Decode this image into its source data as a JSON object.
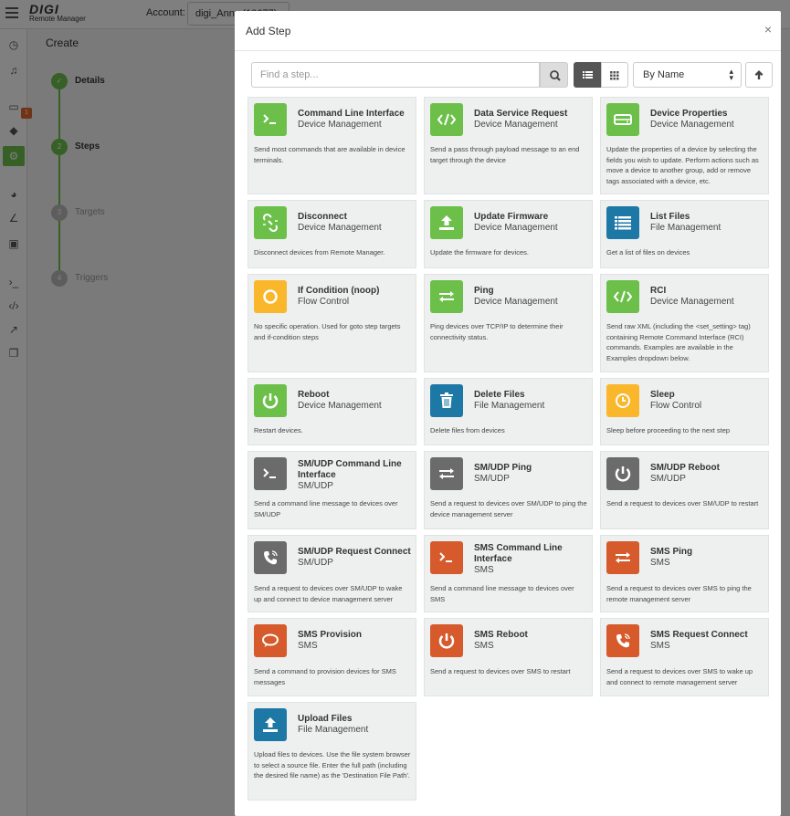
{
  "background": {
    "brand": "DIGI",
    "brand_sub": "Remote Manager",
    "account_label": "Account:",
    "account_value": "digi_Anny (10677)",
    "page_title": "Create",
    "wizard_steps": [
      {
        "num": "",
        "label": "Details",
        "done": true
      },
      {
        "num": "2",
        "label": "Steps",
        "done": true
      },
      {
        "num": "3",
        "label": "Targets",
        "done": false
      },
      {
        "num": "4",
        "label": "Triggers",
        "done": false
      }
    ],
    "rail_badge": "1"
  },
  "modal": {
    "title": "Add Step",
    "close_glyph": "×",
    "search_placeholder": "Find a step...",
    "sort_value": "By Name"
  },
  "colors": {
    "green": "#6cc04a",
    "blue": "#1e78a6",
    "yellow": "#fbb72c",
    "grey": "#6b6b6b",
    "orange": "#d65a2b"
  },
  "steps": [
    {
      "title": "Command Line Interface",
      "category": "Device Management",
      "desc": "Send most commands that are available in device terminals.",
      "icon": "terminal-icon",
      "color": "green"
    },
    {
      "title": "Data Service Request",
      "category": "Device Management",
      "desc": "Send a pass through payload message to an end target through the device",
      "icon": "code-icon",
      "color": "green"
    },
    {
      "title": "Device Properties",
      "category": "Device Management",
      "desc": "Update the properties of a device by selecting the fields you wish to update. Perform actions such as move a device to another group, add or remove tags associated with a device, etc.",
      "icon": "hdd-icon",
      "color": "green"
    },
    {
      "title": "Disconnect",
      "category": "Device Management",
      "desc": "Disconnect devices from Remote Manager.",
      "icon": "unlink-icon",
      "color": "green"
    },
    {
      "title": "Update Firmware",
      "category": "Device Management",
      "desc": "Update the firmware for devices.",
      "icon": "upload-icon",
      "color": "green"
    },
    {
      "title": "List Files",
      "category": "File Management",
      "desc": "Get a list of files on devices",
      "icon": "list-icon",
      "color": "blue"
    },
    {
      "title": "If Condition (noop)",
      "category": "Flow Control",
      "desc": "No specific operation. Used for goto step targets and if-condition steps",
      "icon": "circle-icon",
      "color": "yellow"
    },
    {
      "title": "Ping",
      "category": "Device Management",
      "desc": "Ping devices over TCP/IP to determine their connectivity status.",
      "icon": "exchange-icon",
      "color": "green"
    },
    {
      "title": "RCI",
      "category": "Device Management",
      "desc": "Send raw XML (including the <set_setting> tag) containing Remote Command Interface (RCI) commands. Examples are available in the Examples dropdown below.",
      "icon": "code-icon",
      "color": "green"
    },
    {
      "title": "Reboot",
      "category": "Device Management",
      "desc": "Restart devices.",
      "icon": "power-icon",
      "color": "green"
    },
    {
      "title": "Delete Files",
      "category": "File Management",
      "desc": "Delete files from devices",
      "icon": "trash-icon",
      "color": "blue"
    },
    {
      "title": "Sleep",
      "category": "Flow Control",
      "desc": "Sleep before proceeding to the next step",
      "icon": "clock-icon",
      "color": "yellow"
    },
    {
      "title": "SM/UDP Command Line Interface",
      "category": "SM/UDP",
      "desc": "Send a command line message to devices over SM/UDP",
      "icon": "terminal-icon",
      "color": "grey"
    },
    {
      "title": "SM/UDP Ping",
      "category": "SM/UDP",
      "desc": "Send a request to devices over SM/UDP to ping the device management server",
      "icon": "exchange-icon",
      "color": "grey"
    },
    {
      "title": "SM/UDP Reboot",
      "category": "SM/UDP",
      "desc": "Send a request to devices over SM/UDP to restart",
      "icon": "power-icon",
      "color": "grey"
    },
    {
      "title": "SM/UDP Request Connect",
      "category": "SM/UDP",
      "desc": "Send a request to devices over SM/UDP to wake up and connect to device management server",
      "icon": "phone-icon",
      "color": "grey"
    },
    {
      "title": "SMS Command Line Interface",
      "category": "SMS",
      "desc": "Send a command line message to devices over SMS",
      "icon": "terminal-icon",
      "color": "orange"
    },
    {
      "title": "SMS Ping",
      "category": "SMS",
      "desc": "Send a request to devices over SMS to ping the remote management server",
      "icon": "exchange-icon",
      "color": "orange"
    },
    {
      "title": "SMS Provision",
      "category": "SMS",
      "desc": "Send a command to provision devices for SMS messages",
      "icon": "comment-icon",
      "color": "orange"
    },
    {
      "title": "SMS Reboot",
      "category": "SMS",
      "desc": "Send a request to devices over SMS to restart",
      "icon": "power-icon",
      "color": "orange"
    },
    {
      "title": "SMS Request Connect",
      "category": "SMS",
      "desc": "Send a request to devices over SMS to wake up and connect to remote management server",
      "icon": "phone-icon",
      "color": "orange"
    },
    {
      "title": "Upload Files",
      "category": "File Management",
      "desc": "Upload files to devices. Use the file system browser to select a source file. Enter the full path (including the desired file name) as the 'Destination File Path'.",
      "icon": "upload-icon",
      "color": "blue"
    }
  ]
}
